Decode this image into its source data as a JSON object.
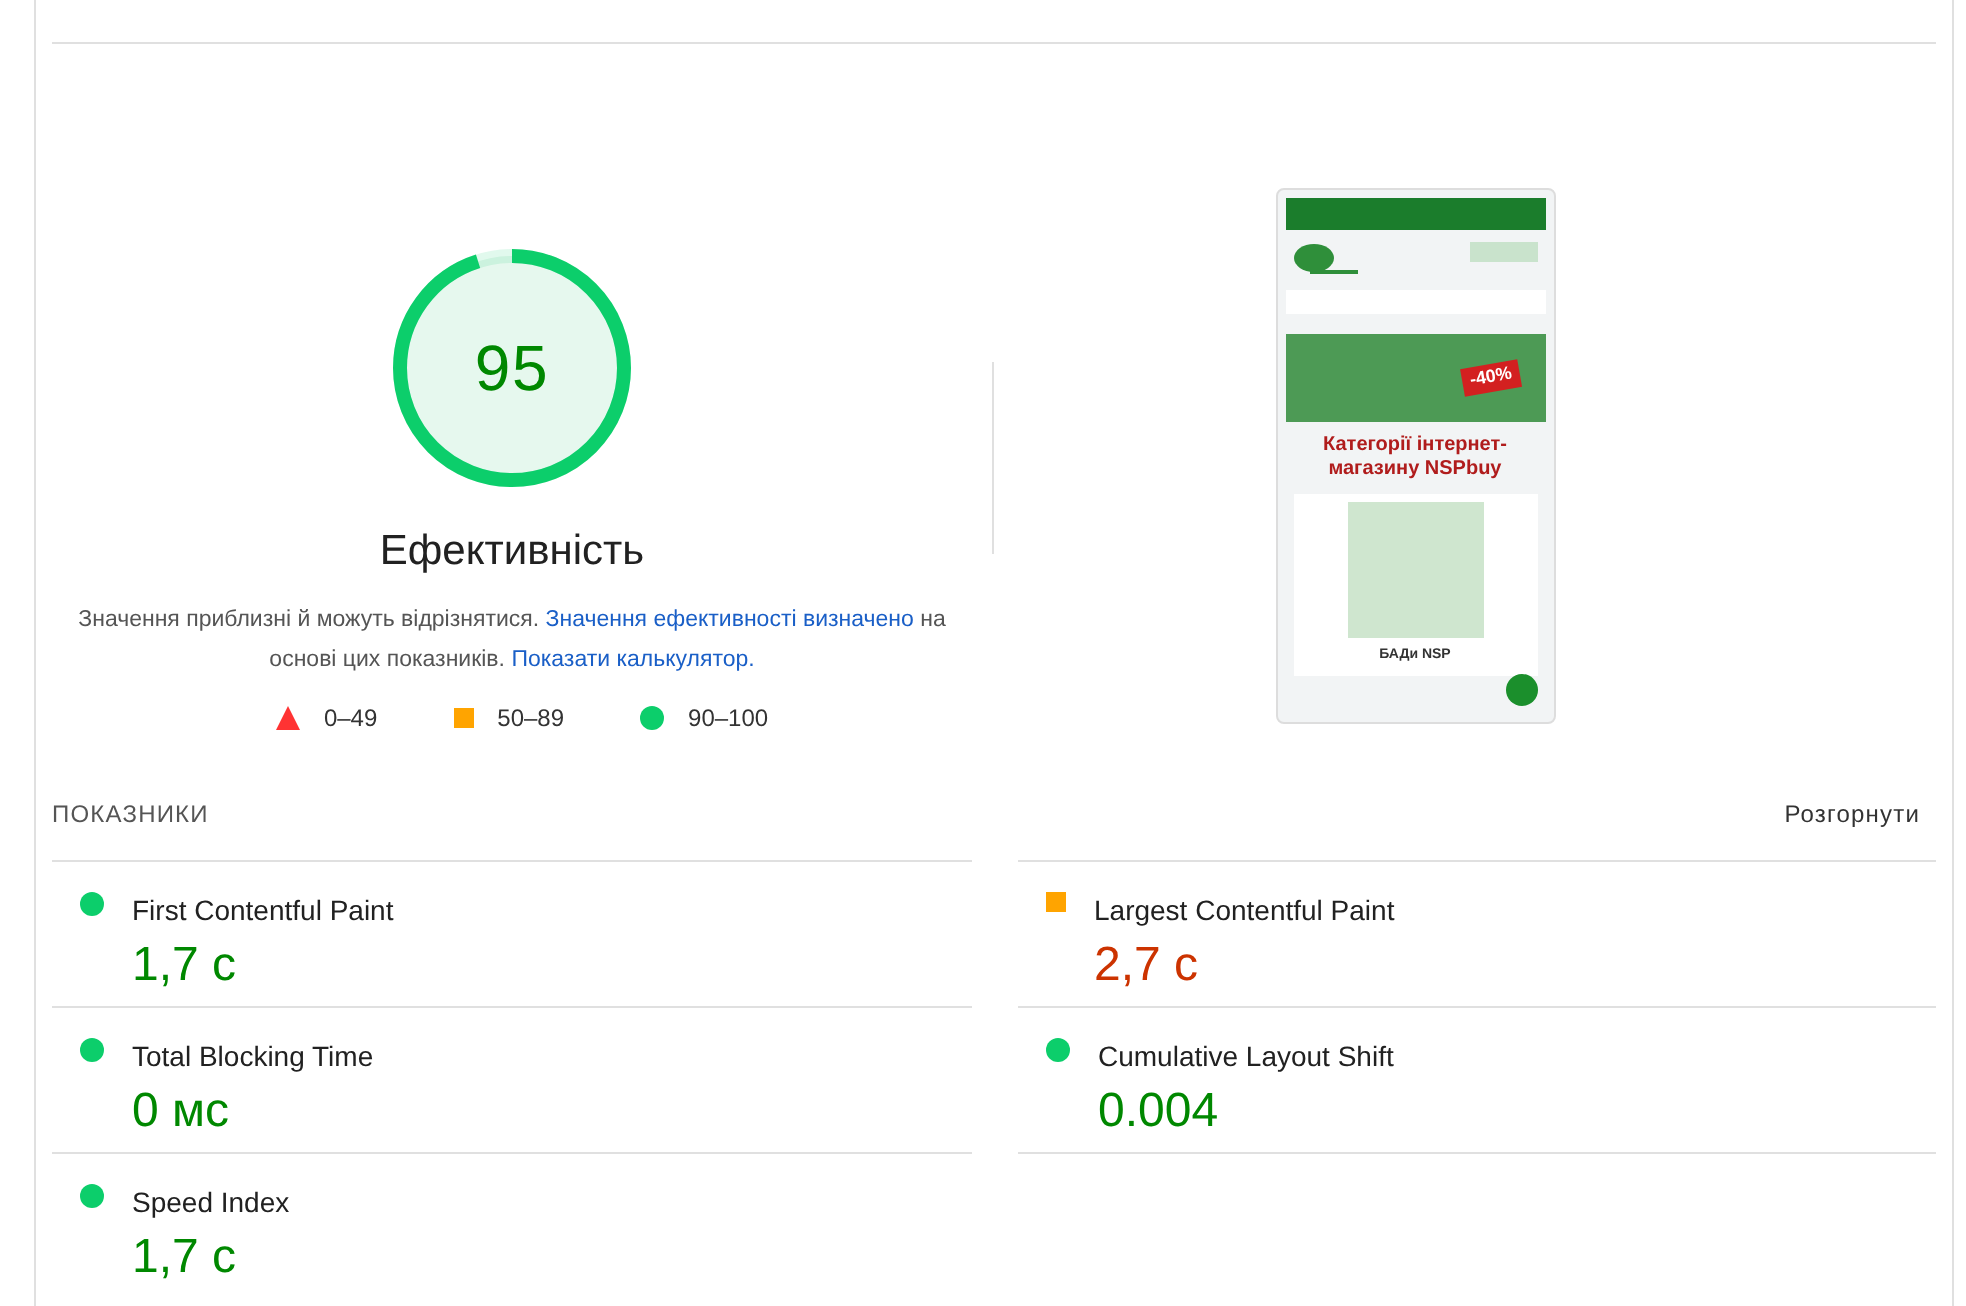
{
  "gauge": {
    "score": "95",
    "level": 0.95,
    "kind": "pass",
    "title": "Ефективність"
  },
  "description": {
    "text": "Значення приблизні й можуть відрізнятися.",
    "link_1": "Значення ефективності визначено",
    "middle": "на основі цих показників.",
    "link_2": "Показати калькулятор."
  },
  "legend": [
    {
      "kind": "fail",
      "label": "0–49"
    },
    {
      "kind": "average",
      "label": "50–89"
    },
    {
      "kind": "pass",
      "label": "90–100"
    }
  ],
  "screenshot": {
    "heading": "Категорії інтернет-магазину NSPbuy",
    "badge": "-40%",
    "product": "БАДи NSP"
  },
  "metrics_header": {
    "title": "ПОКАЗНИКИ",
    "toggle": "Розгорнути"
  },
  "metrics": [
    {
      "name": "First Contentful Paint",
      "value": "1,7 с",
      "kind": "pass"
    },
    {
      "name": "Largest Contentful Paint",
      "value": "2,7 с",
      "kind": "average"
    },
    {
      "name": "Total Blocking Time",
      "value": "0 мс",
      "kind": "pass"
    },
    {
      "name": "Cumulative Layout Shift",
      "value": "0.004",
      "kind": "pass"
    },
    {
      "name": "Speed Index",
      "value": "1,7 с",
      "kind": "pass"
    }
  ]
}
